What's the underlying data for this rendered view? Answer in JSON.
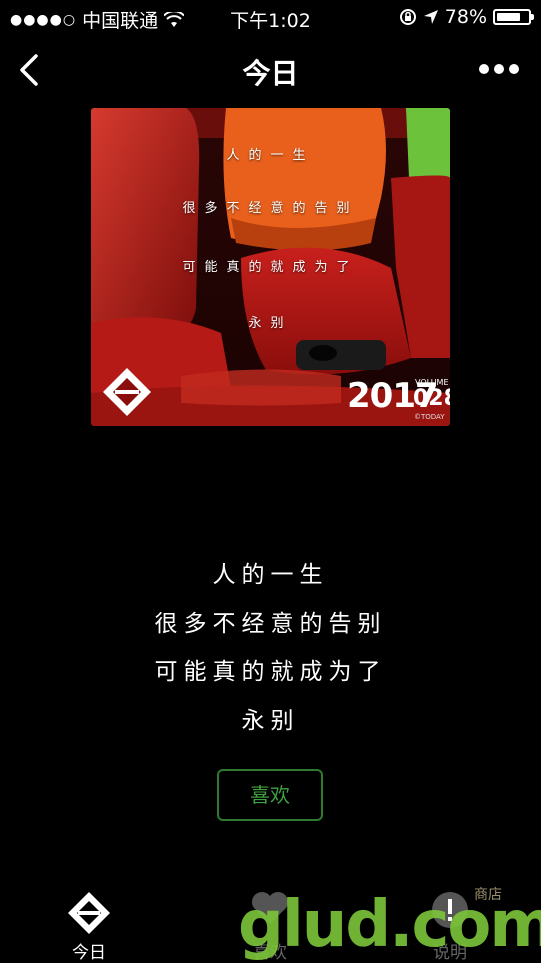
{
  "status_bar": {
    "carrier": "中国联通",
    "time": "下午1:02",
    "battery_percent": "78%",
    "battery_level": 0.78,
    "signal_icon": "signal-dots-icon",
    "wifi_icon": "wifi-icon",
    "lock_icon": "orientation-lock-icon",
    "location_icon": "location-arrow-icon",
    "battery_icon": "battery-icon"
  },
  "nav": {
    "title": "今日",
    "back_icon": "chevron-left-icon",
    "more_icon": "more-horizontal-icon"
  },
  "cover": {
    "lines": [
      "人的一生",
      "很多不经意的告别",
      "可能真的就成为了",
      "永别"
    ],
    "year": "2017",
    "volume_label": "VOLUME",
    "volume": "028",
    "brand": "©TODAY",
    "logo_icon": "today-logo-icon"
  },
  "quote": {
    "lines": [
      "人的一生",
      "很多不经意的告别",
      "可能真的就成为了",
      "永别"
    ]
  },
  "like_button": {
    "label": "喜欢",
    "color": "#3ea03e"
  },
  "tabs": [
    {
      "label": "今日",
      "icon": "today-logo-icon",
      "active": true
    },
    {
      "label": "喜欢",
      "icon": "heart-icon",
      "active": false
    },
    {
      "label": "说明",
      "icon": "info-icon",
      "active": false
    }
  ],
  "watermark": {
    "main": "glud.com",
    "sub": "商店"
  },
  "colors": {
    "accent": "#3ea03e",
    "background": "#000000"
  }
}
